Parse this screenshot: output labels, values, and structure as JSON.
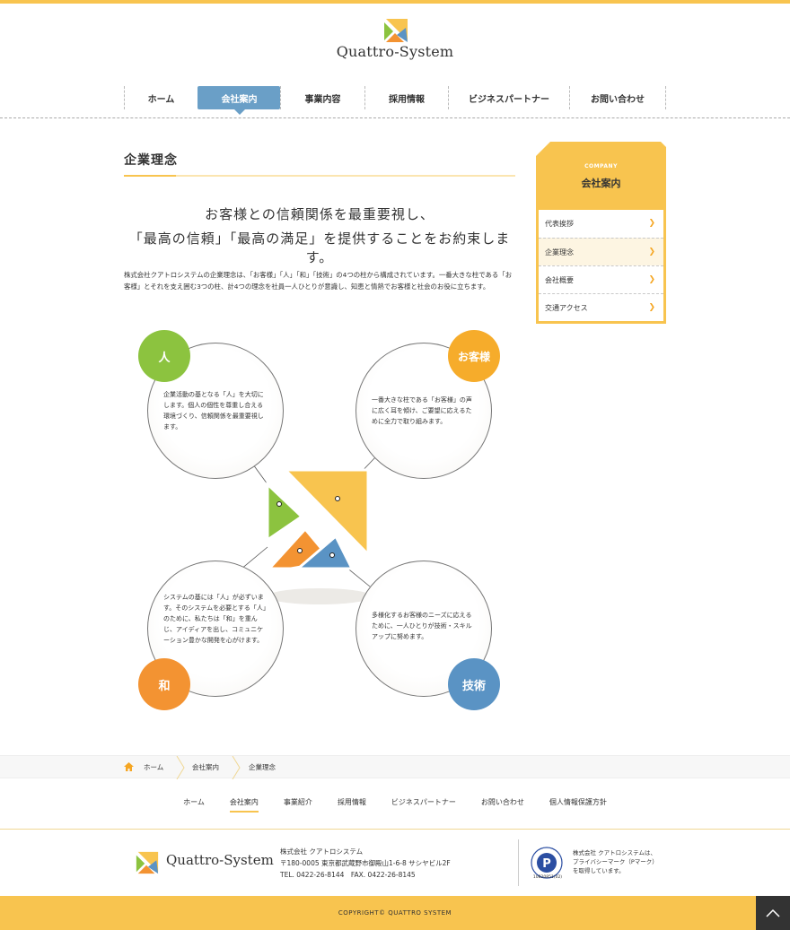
{
  "header": {
    "logo_text": "Quattro-System",
    "nav": [
      {
        "label": "ホーム"
      },
      {
        "label": "会社案内"
      },
      {
        "label": "事業内容"
      },
      {
        "label": "採用情報"
      },
      {
        "label": "ビジネスパートナー"
      },
      {
        "label": "お問い合わせ"
      }
    ]
  },
  "main": {
    "title": "企業理念",
    "lead_line1": "お客様との信頼関係を最重要視し、",
    "lead_line2": "「最高の信頼」「最高の満足」を提供することをお約束します。",
    "intro": "株式会社クアトロシステムの企業理念は、「お客様」「人」「和」「技術」の4つの柱から構成されています。一番大きな柱である「お客様」とそれを支え囲む3つの柱、計4つの理念を社員一人ひとりが意識し、知恵と情熱でお客様と社会のお役に立ちます。",
    "pillars": [
      {
        "badge": "人",
        "text": "企業活動の基となる「人」を大切にします。個人の個性を尊重し合える環境づくり、信頼関係を最重要視します。",
        "color": "#8cc33f"
      },
      {
        "badge": "お客様",
        "text": "一番大きな柱である「お客様」の声に広く耳を傾け、ご要望に応えるために全力で取り組みます。",
        "color": "#f6ac2b"
      },
      {
        "badge": "和",
        "text": "システムの基には「人」が必ずいます。そのシステムを必要とする「人」のために、私たちは「和」を重んじ、アイディアを出し、コミュニケーション豊かな開発を心がけます。",
        "color": "#f39332"
      },
      {
        "badge": "技術",
        "text": "多様化するお客様のニーズに応えるために、一人ひとりが技術・スキルアップに努めます。",
        "color": "#5a93c4"
      }
    ]
  },
  "sidebar": {
    "eng": "COMPANY",
    "title": "会社案内",
    "items": [
      {
        "label": "代表挨拶"
      },
      {
        "label": "企業理念"
      },
      {
        "label": "会社概要"
      },
      {
        "label": "交通アクセス"
      }
    ]
  },
  "breadcrumb": [
    "ホーム",
    "会社案内",
    "企業理念"
  ],
  "footer": {
    "nav": [
      "ホーム",
      "会社案内",
      "事業紹介",
      "採用情報",
      "ビジネスパートナー",
      "お問い合わせ",
      "個人情報保護方針"
    ],
    "logo_text": "Quattro-System",
    "company": "株式会社 クアトロシステム",
    "address": "〒180-0005 東京都武蔵野市御殿山1-6-8 サシヤビル2F",
    "tel": "TEL. 0422-26-8144　FAX. 0422-26-8145",
    "pmark_number": "10820851(02)",
    "pmark_text1": "株式会社 クアトロシステムは、",
    "pmark_text2": "プライバシーマーク（Pマーク）",
    "pmark_text3": "を取得しています。",
    "copyright": "COPYRIGHT© QUATTRO SYSTEM"
  },
  "colors": {
    "accent": "#f8c44f",
    "nav_active": "#6a9fc7"
  }
}
